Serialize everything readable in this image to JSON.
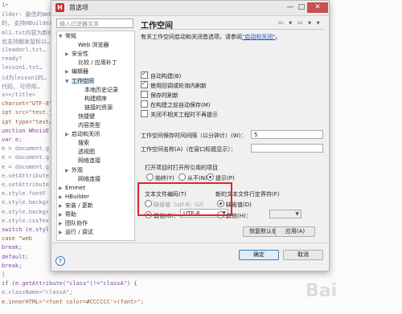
{
  "background_code": [
    {
      "text": "1>",
      "cls": ""
    },
    {
      "text": "ilder: 最佳的Web前端开发…",
      "cls": ""
    },
    {
      "text": "的, 支持HBuilder …",
      "cls": ""
    },
    {
      "text": "ml1.txt内容为新修改的",
      "cls": ""
    },
    {
      "text": "也支持触发鼠标以…",
      "cls": ""
    },
    {
      "text": "ileaderl.txt…",
      "cls": ""
    },
    {
      "text": "ready?",
      "cls": ""
    },
    {
      "text": "lesson1.txt…",
      "cls": ""
    },
    {
      "text": "id为lesson1的…",
      "cls": ""
    },
    {
      "text": "代码, 可停用…",
      "cls": ""
    },
    {
      "text": "s></title>",
      "cls": ""
    },
    {
      "text": "  charset=\"UTF-8\"",
      "cls": "str"
    },
    {
      "text": "ipt src=\"test.js\"",
      "cls": "str"
    },
    {
      "text": "ipt type=\"text/jav",
      "cls": "str"
    },
    {
      "text": "unction WhoisE (",
      "cls": "kw"
    },
    {
      "text": "   var e;",
      "cls": "kw"
    },
    {
      "text": "   e = document.g",
      "cls": ""
    },
    {
      "text": "   e = document.g",
      "cls": ""
    },
    {
      "text": "   e = document.g",
      "cls": ""
    },
    {
      "text": "   e.setAttribute",
      "cls": ""
    },
    {
      "text": "   e.setAttribute",
      "cls": ""
    },
    {
      "text": "   e.style.fontF",
      "cls": ""
    },
    {
      "text": "   e.style.backgr",
      "cls": ""
    },
    {
      "text": "   e.style.backgr",
      "cls": ""
    },
    {
      "text": "   e.style.cssTex",
      "cls": ""
    },
    {
      "text": "   switch (e.styl",
      "cls": "kw"
    },
    {
      "text": "      case \"web",
      "cls": "str"
    },
    {
      "text": "         break;",
      "cls": "kw"
    },
    {
      "text": "      default:",
      "cls": "kw"
    },
    {
      "text": "         break;",
      "cls": "kw"
    },
    {
      "text": "   }",
      "cls": ""
    },
    {
      "text": "if (e.getAttribute(\"class\")!=\"classA\") {",
      "cls": "kw"
    },
    {
      "text": "    e.className=\"classA\";",
      "cls": ""
    },
    {
      "text": "  e.innerHTML=\"<font color=#CCCCCC'>(font>\";",
      "cls": "str"
    }
  ],
  "dialog": {
    "title": "首选项",
    "app_icon": "H",
    "minimize": "—",
    "maximize": "□",
    "close": "✕"
  },
  "tree": {
    "filter_placeholder": "输入过滤器文本",
    "items": [
      {
        "label": "常规",
        "arrow": "▼",
        "indent": 0
      },
      {
        "label": "Web 浏览器",
        "arrow": "",
        "indent": 2
      },
      {
        "label": "安全性",
        "arrow": "▶",
        "indent": 1
      },
      {
        "label": "比较 / 应用补丁",
        "arrow": "",
        "indent": 2
      },
      {
        "label": "编辑器",
        "arrow": "▶",
        "indent": 1
      },
      {
        "label": "工作空间",
        "arrow": "▼",
        "indent": 1,
        "selected": true
      },
      {
        "label": "本地历史记录",
        "arrow": "",
        "indent": 3
      },
      {
        "label": "构建顺序",
        "arrow": "",
        "indent": 3
      },
      {
        "label": "链接的资源",
        "arrow": "",
        "indent": 3
      },
      {
        "label": "快捷键",
        "arrow": "",
        "indent": 2
      },
      {
        "label": "内容类型",
        "arrow": "",
        "indent": 2
      },
      {
        "label": "启动和关闭",
        "arrow": "▶",
        "indent": 1
      },
      {
        "label": "搜索",
        "arrow": "",
        "indent": 2
      },
      {
        "label": "透视图",
        "arrow": "",
        "indent": 2
      },
      {
        "label": "网络连接",
        "arrow": "",
        "indent": 2
      },
      {
        "label": "外观",
        "arrow": "▶",
        "indent": 1
      },
      {
        "label": "网络连接",
        "arrow": "",
        "indent": 2
      },
      {
        "label": "Emmet",
        "arrow": "▶",
        "indent": 0
      },
      {
        "label": "HBuilder",
        "arrow": "▶",
        "indent": 0
      },
      {
        "label": "安装 / 更新",
        "arrow": "▶",
        "indent": 0
      },
      {
        "label": "帮助",
        "arrow": "▶",
        "indent": 0
      },
      {
        "label": "团队协作",
        "arrow": "▶",
        "indent": 0
      },
      {
        "label": "运行 / 调试",
        "arrow": "▶",
        "indent": 0
      }
    ]
  },
  "pane": {
    "title": "工作空间",
    "nav": "⇦ ▾ ⇨ ▾ ▾",
    "desc_prefix": "有关工作空间启动和关闭首选项，请参阅",
    "desc_link": "\"启动和关闭\"",
    "desc_suffix": "。",
    "checkboxes": [
      {
        "label": "自动构建(B)",
        "checked": true
      },
      {
        "label": "使用回调或轮询内刷新",
        "checked": true
      },
      {
        "label": "保存时刷新",
        "checked": false
      },
      {
        "label": "在构建之前自动保存(M)",
        "checked": false
      },
      {
        "label": "关闭不相关工程时不再提示",
        "checked": false
      }
    ],
    "save_interval_label": "工作空间保存时间间隔（以分钟计）(W)：",
    "save_interval_value": "5",
    "workspace_name_label": "工作空间名称(A)（在窗口标题显示）：",
    "workspace_name_value": "",
    "open_ref_label": "打开项目时打开所引用的项目",
    "open_ref_options": [
      "始终(Y)",
      "从不(N)",
      "提示(P)"
    ],
    "open_ref_selected": 2,
    "encoding_label": "文本文件编码(T)",
    "encoding_default": "缺省值（utf-8）(U)",
    "encoding_other": "其他(O)：",
    "encoding_value": "UTF-8",
    "newline_label": "新的文本文件行定界符(F)",
    "newline_default": "缺省值(D)",
    "newline_other": "其他(H)："
  },
  "buttons": {
    "restore_defaults": "恢复默认值(D)",
    "apply": "应用(A)",
    "ok": "确定",
    "cancel": "取消",
    "help": "?"
  },
  "watermark": "Bai"
}
